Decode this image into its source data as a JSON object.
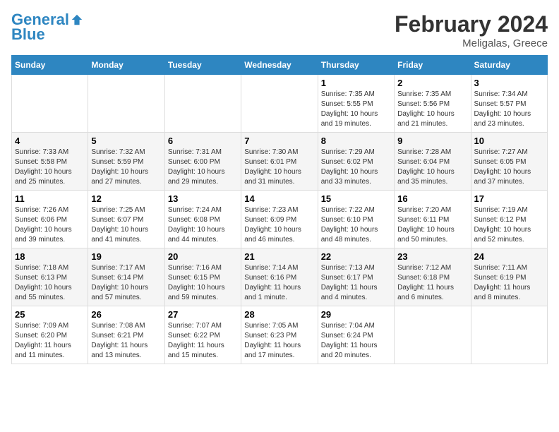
{
  "header": {
    "logo_line1": "General",
    "logo_line2": "Blue",
    "month_title": "February 2024",
    "subtitle": "Meligalas, Greece"
  },
  "weekdays": [
    "Sunday",
    "Monday",
    "Tuesday",
    "Wednesday",
    "Thursday",
    "Friday",
    "Saturday"
  ],
  "weeks": [
    [
      {
        "day": "",
        "info": ""
      },
      {
        "day": "",
        "info": ""
      },
      {
        "day": "",
        "info": ""
      },
      {
        "day": "",
        "info": ""
      },
      {
        "day": "1",
        "info": "Sunrise: 7:35 AM\nSunset: 5:55 PM\nDaylight: 10 hours\nand 19 minutes."
      },
      {
        "day": "2",
        "info": "Sunrise: 7:35 AM\nSunset: 5:56 PM\nDaylight: 10 hours\nand 21 minutes."
      },
      {
        "day": "3",
        "info": "Sunrise: 7:34 AM\nSunset: 5:57 PM\nDaylight: 10 hours\nand 23 minutes."
      }
    ],
    [
      {
        "day": "4",
        "info": "Sunrise: 7:33 AM\nSunset: 5:58 PM\nDaylight: 10 hours\nand 25 minutes."
      },
      {
        "day": "5",
        "info": "Sunrise: 7:32 AM\nSunset: 5:59 PM\nDaylight: 10 hours\nand 27 minutes."
      },
      {
        "day": "6",
        "info": "Sunrise: 7:31 AM\nSunset: 6:00 PM\nDaylight: 10 hours\nand 29 minutes."
      },
      {
        "day": "7",
        "info": "Sunrise: 7:30 AM\nSunset: 6:01 PM\nDaylight: 10 hours\nand 31 minutes."
      },
      {
        "day": "8",
        "info": "Sunrise: 7:29 AM\nSunset: 6:02 PM\nDaylight: 10 hours\nand 33 minutes."
      },
      {
        "day": "9",
        "info": "Sunrise: 7:28 AM\nSunset: 6:04 PM\nDaylight: 10 hours\nand 35 minutes."
      },
      {
        "day": "10",
        "info": "Sunrise: 7:27 AM\nSunset: 6:05 PM\nDaylight: 10 hours\nand 37 minutes."
      }
    ],
    [
      {
        "day": "11",
        "info": "Sunrise: 7:26 AM\nSunset: 6:06 PM\nDaylight: 10 hours\nand 39 minutes."
      },
      {
        "day": "12",
        "info": "Sunrise: 7:25 AM\nSunset: 6:07 PM\nDaylight: 10 hours\nand 41 minutes."
      },
      {
        "day": "13",
        "info": "Sunrise: 7:24 AM\nSunset: 6:08 PM\nDaylight: 10 hours\nand 44 minutes."
      },
      {
        "day": "14",
        "info": "Sunrise: 7:23 AM\nSunset: 6:09 PM\nDaylight: 10 hours\nand 46 minutes."
      },
      {
        "day": "15",
        "info": "Sunrise: 7:22 AM\nSunset: 6:10 PM\nDaylight: 10 hours\nand 48 minutes."
      },
      {
        "day": "16",
        "info": "Sunrise: 7:20 AM\nSunset: 6:11 PM\nDaylight: 10 hours\nand 50 minutes."
      },
      {
        "day": "17",
        "info": "Sunrise: 7:19 AM\nSunset: 6:12 PM\nDaylight: 10 hours\nand 52 minutes."
      }
    ],
    [
      {
        "day": "18",
        "info": "Sunrise: 7:18 AM\nSunset: 6:13 PM\nDaylight: 10 hours\nand 55 minutes."
      },
      {
        "day": "19",
        "info": "Sunrise: 7:17 AM\nSunset: 6:14 PM\nDaylight: 10 hours\nand 57 minutes."
      },
      {
        "day": "20",
        "info": "Sunrise: 7:16 AM\nSunset: 6:15 PM\nDaylight: 10 hours\nand 59 minutes."
      },
      {
        "day": "21",
        "info": "Sunrise: 7:14 AM\nSunset: 6:16 PM\nDaylight: 11 hours\nand 1 minute."
      },
      {
        "day": "22",
        "info": "Sunrise: 7:13 AM\nSunset: 6:17 PM\nDaylight: 11 hours\nand 4 minutes."
      },
      {
        "day": "23",
        "info": "Sunrise: 7:12 AM\nSunset: 6:18 PM\nDaylight: 11 hours\nand 6 minutes."
      },
      {
        "day": "24",
        "info": "Sunrise: 7:11 AM\nSunset: 6:19 PM\nDaylight: 11 hours\nand 8 minutes."
      }
    ],
    [
      {
        "day": "25",
        "info": "Sunrise: 7:09 AM\nSunset: 6:20 PM\nDaylight: 11 hours\nand 11 minutes."
      },
      {
        "day": "26",
        "info": "Sunrise: 7:08 AM\nSunset: 6:21 PM\nDaylight: 11 hours\nand 13 minutes."
      },
      {
        "day": "27",
        "info": "Sunrise: 7:07 AM\nSunset: 6:22 PM\nDaylight: 11 hours\nand 15 minutes."
      },
      {
        "day": "28",
        "info": "Sunrise: 7:05 AM\nSunset: 6:23 PM\nDaylight: 11 hours\nand 17 minutes."
      },
      {
        "day": "29",
        "info": "Sunrise: 7:04 AM\nSunset: 6:24 PM\nDaylight: 11 hours\nand 20 minutes."
      },
      {
        "day": "",
        "info": ""
      },
      {
        "day": "",
        "info": ""
      }
    ]
  ]
}
